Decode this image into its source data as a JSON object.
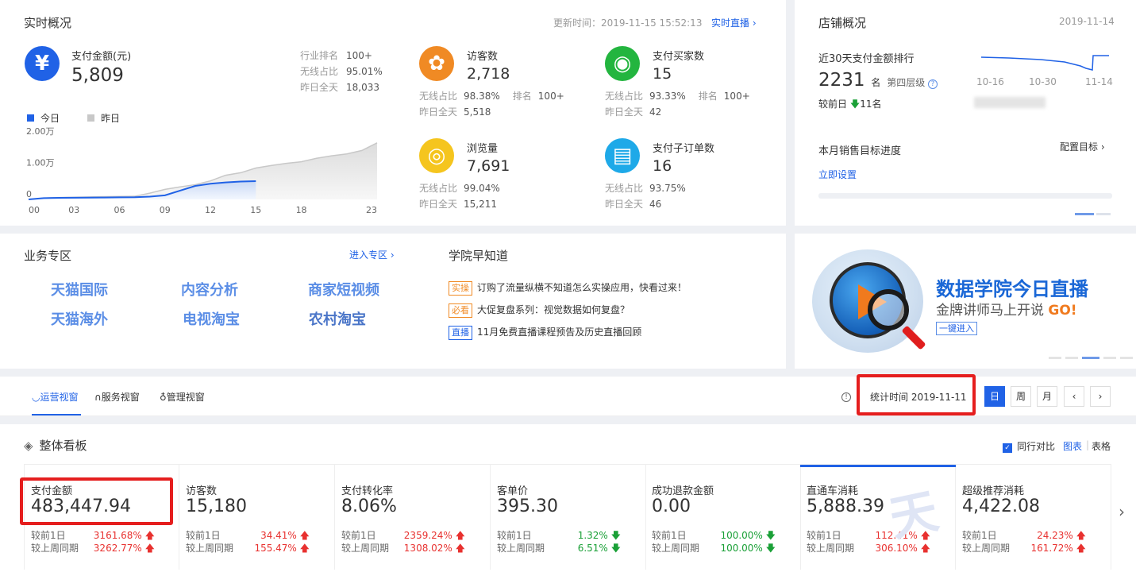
{
  "realtime": {
    "title": "实时概况",
    "update_time": "更新时间：2019-11-15 15:52:13",
    "live_link": "实时直播",
    "pay": {
      "label": "支付金额(元)",
      "value": "5,809",
      "rank_label": "行业排名",
      "rank": "100+",
      "wireless_label": "无线占比",
      "wireless": "95.01%",
      "yday_label": "昨日全天",
      "yday": "18,033"
    },
    "legend_today": "今日",
    "legend_yday": "昨日",
    "metrics": [
      {
        "label": "访客数",
        "value": "2,718",
        "r1l": "无线占比",
        "r1": "98.38%",
        "r1b": "排名",
        "r1bv": "100+",
        "r2l": "昨日全天",
        "r2": "5,518",
        "color": "#f08a24"
      },
      {
        "label": "支付买家数",
        "value": "15",
        "r1l": "无线占比",
        "r1": "93.33%",
        "r1b": "排名",
        "r1bv": "100+",
        "r2l": "昨日全天",
        "r2": "42",
        "color": "#23b53f"
      },
      {
        "label": "浏览量",
        "value": "7,691",
        "r1l": "无线占比",
        "r1": "99.04%",
        "r1b": "",
        "r1bv": "",
        "r2l": "昨日全天",
        "r2": "15,211",
        "color": "#f5c51e"
      },
      {
        "label": "支付子订单数",
        "value": "16",
        "r1l": "无线占比",
        "r1": "93.75%",
        "r1b": "",
        "r1bv": "",
        "r2l": "昨日全天",
        "r2": "46",
        "color": "#1ea9e8"
      }
    ]
  },
  "chart_data": {
    "type": "area",
    "x_ticks": [
      "00",
      "03",
      "06",
      "09",
      "12",
      "15",
      "18",
      "23"
    ],
    "y_ticks": [
      "2.00万",
      "1.00万",
      "0"
    ],
    "ylim": [
      0,
      20000
    ],
    "series": [
      {
        "name": "今日",
        "x": [
          0,
          1,
          2,
          3,
          4,
          5,
          6,
          7,
          8,
          9,
          10,
          11,
          12,
          13,
          14,
          15
        ],
        "values": [
          0,
          400,
          500,
          550,
          580,
          600,
          650,
          700,
          900,
          1300,
          2800,
          4300,
          5000,
          5400,
          5700,
          5809
        ]
      },
      {
        "name": "昨日",
        "x": [
          0,
          1,
          2,
          3,
          4,
          5,
          6,
          7,
          8,
          9,
          10,
          11,
          12,
          13,
          14,
          15,
          16,
          17,
          18,
          19,
          20,
          21,
          22,
          23
        ],
        "values": [
          0,
          400,
          600,
          700,
          800,
          900,
          950,
          1000,
          2000,
          3200,
          4000,
          4700,
          5900,
          7700,
          8500,
          10000,
          10800,
          11500,
          12000,
          13100,
          13900,
          14500,
          15600,
          18033
        ]
      }
    ],
    "colors": {
      "today": "#2062e6",
      "yday": "#c8c8c8"
    }
  },
  "store": {
    "title": "店铺概况",
    "date": "2019-11-14",
    "rank_title": "近30天支付金额排行",
    "rank_value": "2231",
    "rank_unit": "名",
    "tier": "第四层级",
    "compare_label": "较前日",
    "compare_value": "11名",
    "spark_ticks": [
      "10-16",
      "10-30",
      "11-14"
    ],
    "target_title": "本月销售目标进度",
    "config_target": "配置目标",
    "set_now": "立即设置"
  },
  "business": {
    "title": "业务专区",
    "enter": "进入专区",
    "items": [
      "天猫国际",
      "内容分析",
      "商家短视频",
      "天猫海外",
      "电视淘宝",
      "农村淘宝"
    ]
  },
  "academy": {
    "title": "学院早知道",
    "news": [
      {
        "tag": "实操",
        "text": "订购了流量纵横不知道怎么实操应用，快看过来！",
        "color": "#f08a24"
      },
      {
        "tag": "必看",
        "text": "大促复盘系列：视觉数据如何复盘？",
        "color": "#f08a24"
      },
      {
        "tag": "直播",
        "text": "11月免费直播课程预告及历史直播回顾",
        "color": "#2062e6"
      }
    ]
  },
  "banner": {
    "headline": "数据学院今日直播",
    "sub": "金牌讲师马上开说",
    "go": "GO!",
    "cta": "一键进入"
  },
  "tabs": {
    "items": [
      "运营视窗",
      "服务视窗",
      "管理视窗"
    ],
    "stat_time": "统计时间 2019-11-11",
    "periods": [
      "日",
      "周",
      "月"
    ]
  },
  "board": {
    "title": "整体看板",
    "peer_compare": "同行对比",
    "view_chart": "图表",
    "view_table": "表格",
    "kpis": [
      {
        "label": "支付金额",
        "value": "483,447.94",
        "d1l": "较前1日",
        "d1": "3161.68%",
        "d1dir": "up",
        "d2l": "较上周同期",
        "d2": "3262.77%",
        "d2dir": "up"
      },
      {
        "label": "访客数",
        "value": "15,180",
        "d1l": "较前1日",
        "d1": "34.41%",
        "d1dir": "up",
        "d2l": "较上周同期",
        "d2": "155.47%",
        "d2dir": "up"
      },
      {
        "label": "支付转化率",
        "value": "8.06%",
        "d1l": "较前1日",
        "d1": "2359.24%",
        "d1dir": "up",
        "d2l": "较上周同期",
        "d2": "1308.02%",
        "d2dir": "up"
      },
      {
        "label": "客单价",
        "value": "395.30",
        "d1l": "较前1日",
        "d1": "1.32%",
        "d1dir": "down",
        "d2l": "较上周同期",
        "d2": "6.51%",
        "d2dir": "down"
      },
      {
        "label": "成功退款金额",
        "value": "0.00",
        "d1l": "较前1日",
        "d1": "100.00%",
        "d1dir": "down",
        "d2l": "较上周同期",
        "d2": "100.00%",
        "d2dir": "down"
      },
      {
        "label": "直通车消耗",
        "value": "5,888.39",
        "d1l": "较前1日",
        "d1": "112.41%",
        "d1dir": "up",
        "d2l": "较上周同期",
        "d2": "306.10%",
        "d2dir": "up"
      },
      {
        "label": "超级推荐消耗",
        "value": "4,422.08",
        "d1l": "较前1日",
        "d1": "24.23%",
        "d1dir": "up",
        "d2l": "较上周同期",
        "d2": "161.72%",
        "d2dir": "up"
      }
    ]
  }
}
